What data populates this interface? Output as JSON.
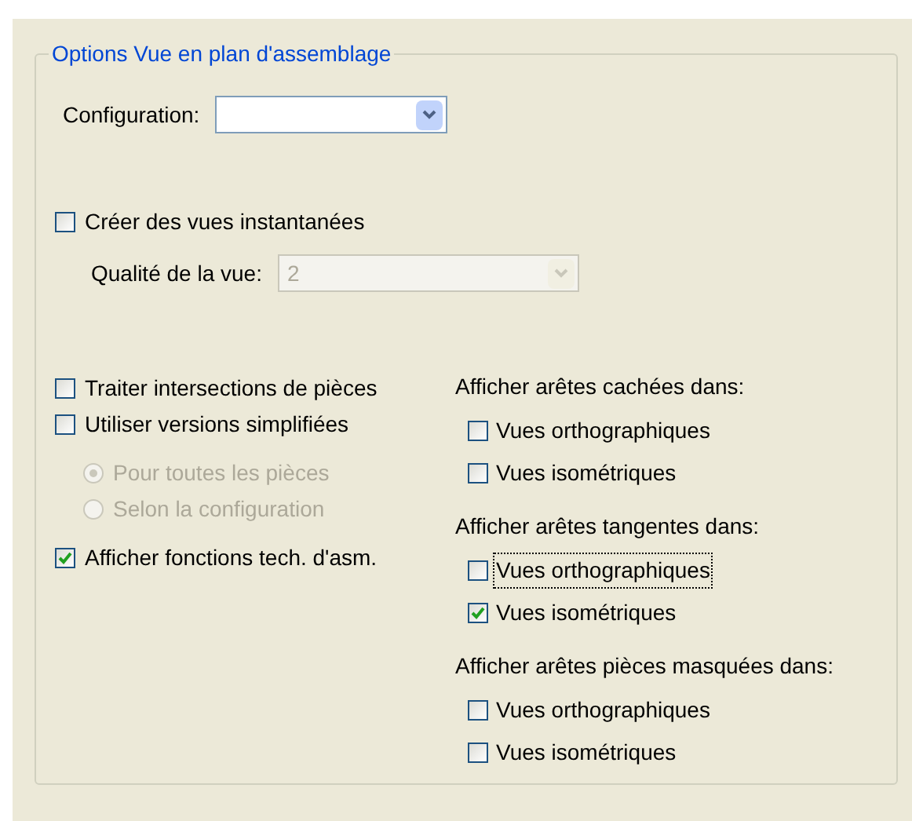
{
  "group_title": "Options Vue en plan d'assemblage",
  "configuration": {
    "label": "Configuration:"
  },
  "snapshot": {
    "label": "Créer des vues instantanées",
    "checked": false
  },
  "quality": {
    "label": "Qualité de la vue:",
    "value": "2",
    "disabled": true
  },
  "left_options": [
    {
      "kind": "checkbox",
      "label": "Traiter intersections de pièces",
      "checked": false,
      "disabled": false
    },
    {
      "kind": "checkbox",
      "label": "Utiliser versions simplifiées",
      "checked": false,
      "disabled": false
    },
    {
      "kind": "radio",
      "label": "Pour toutes les pièces",
      "selected": true,
      "disabled": true
    },
    {
      "kind": "radio",
      "label": "Selon la configuration",
      "selected": false,
      "disabled": true
    },
    {
      "kind": "checkbox",
      "label": "Afficher fonctions tech. d'asm.",
      "checked": true,
      "disabled": false
    }
  ],
  "right_sections": [
    {
      "heading": "Afficher arêtes cachées dans:",
      "items": [
        {
          "label": "Vues orthographiques",
          "checked": false,
          "focused": false
        },
        {
          "label": "Vues isométriques",
          "checked": false,
          "focused": false
        }
      ]
    },
    {
      "heading": "Afficher arêtes tangentes dans:",
      "items": [
        {
          "label": "Vues orthographiques",
          "checked": false,
          "focused": true
        },
        {
          "label": "Vues isométriques",
          "checked": true,
          "focused": false
        }
      ]
    },
    {
      "heading": "Afficher arêtes pièces masquées dans:",
      "items": [
        {
          "label": "Vues orthographiques",
          "checked": false,
          "focused": false
        },
        {
          "label": "Vues isométriques",
          "checked": false,
          "focused": false
        }
      ]
    }
  ]
}
